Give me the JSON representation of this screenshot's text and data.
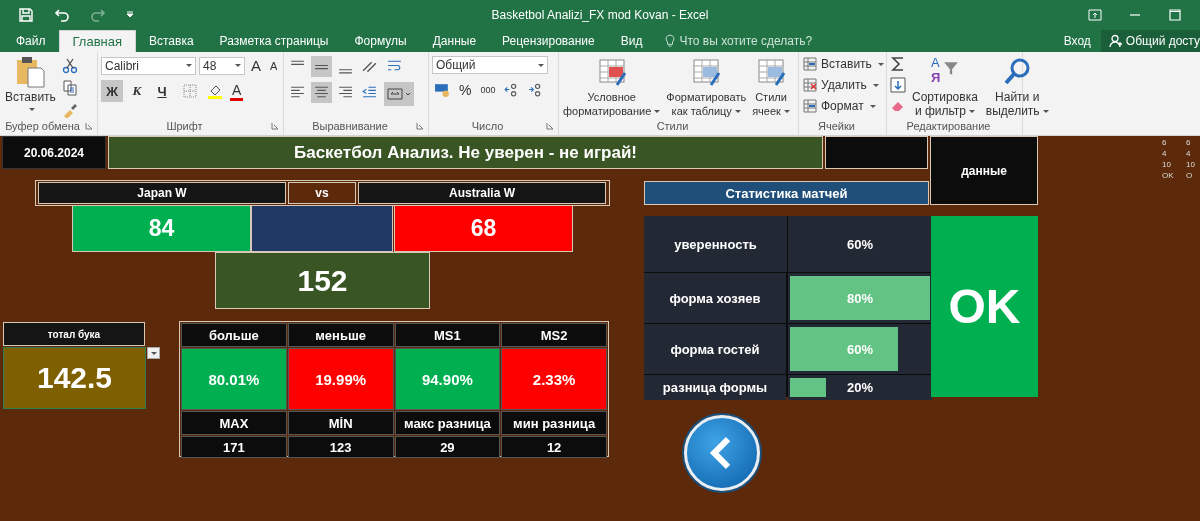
{
  "window": {
    "title": "Basketbol Analizi_FX mod Kovan - Excel"
  },
  "ribbon_tabs": [
    {
      "label": "Файл",
      "selected": false
    },
    {
      "label": "Главная",
      "selected": true
    },
    {
      "label": "Вставка",
      "selected": false
    },
    {
      "label": "Разметка страницы",
      "selected": false
    },
    {
      "label": "Формулы",
      "selected": false
    },
    {
      "label": "Данные",
      "selected": false
    },
    {
      "label": "Рецензирование",
      "selected": false
    },
    {
      "label": "Вид",
      "selected": false
    }
  ],
  "tell_me": {
    "placeholder": "Что вы хотите сделать?"
  },
  "account": {
    "sign_in": "Вход",
    "share": "Общий досту"
  },
  "ribbon": {
    "clipboard": {
      "label": "Буфер обмена",
      "paste": "Вставить"
    },
    "font": {
      "label": "Шрифт",
      "font_name": "Calibri",
      "font_size": "48",
      "grow": "A",
      "shrink": "A",
      "font_color": "A",
      "styles": [
        {
          "label": "Ж",
          "pressed": true
        },
        {
          "label": "К",
          "pressed": false
        },
        {
          "label": "Ч",
          "pressed": false
        }
      ]
    },
    "alignment": {
      "label": "Выравнивание",
      "vertical": [
        {
          "selected": false
        },
        {
          "selected": true
        },
        {
          "selected": false
        }
      ],
      "horizontal": [
        {
          "selected": false
        },
        {
          "selected": true
        },
        {
          "selected": false
        }
      ],
      "merge_on": true
    },
    "number": {
      "label": "Число",
      "format": "Общий",
      "percent": "%",
      "thousands": "000"
    },
    "styles": {
      "label": "Стили",
      "buttons": [
        {
          "lines": [
            "Условное",
            "форматирование"
          ]
        },
        {
          "lines": [
            "Форматировать",
            "как таблицу"
          ]
        },
        {
          "lines": [
            "Стили",
            "ячеек"
          ]
        }
      ]
    },
    "cells": {
      "label": "Ячейки",
      "items": [
        "Вставить",
        "Удалить",
        "Формат"
      ]
    },
    "editing": {
      "label": "Редактирование",
      "sort_glyphs": [
        "А",
        "Я"
      ],
      "buttons": [
        {
          "lines": [
            "Сортировка",
            "и фильтр"
          ]
        },
        {
          "lines": [
            "Найти и",
            "выделить"
          ]
        }
      ]
    }
  },
  "sheet": {
    "date": "20.06.2024",
    "title": "Баскетбол Анализ. Не уверен - не играй!",
    "data_button": "данные",
    "stats_title": "Статистика матчей",
    "match": {
      "home": "Japan W",
      "vs": "vs",
      "away": "Australia W",
      "home_score": "84",
      "away_score": "68",
      "total": "152"
    },
    "bookmaker_total": {
      "label": "тотал бука",
      "value": "142.5"
    },
    "odds": {
      "headers": [
        "больше",
        "меньше",
        "MS1",
        "MS2"
      ],
      "values": [
        {
          "text": "80.01%",
          "color": "#00b050"
        },
        {
          "text": "19.99%",
          "color": "#ff0000"
        },
        {
          "text": "94.90%",
          "color": "#00b050"
        },
        {
          "text": "2.33%",
          "color": "#ff0000"
        }
      ],
      "stat_headers": [
        "MAX",
        "MİN",
        "макс разница",
        "мин разница"
      ],
      "stat_values": [
        "171",
        "123",
        "29",
        "12"
      ]
    },
    "stats": [
      {
        "label": "уверенность",
        "value": "60%",
        "kind": "plain"
      },
      {
        "label": "форма хозяев",
        "value": "80%",
        "kind": "bar",
        "level": 1
      },
      {
        "label": "форма гостей",
        "value": "60%",
        "kind": "bar",
        "level": 0.75
      },
      {
        "label": "разница формы",
        "value": "20%",
        "kind": "bar",
        "level": 0.25
      }
    ],
    "verdict": "OK",
    "side_numbers": [
      [
        "6",
        "6"
      ],
      [
        "4",
        "4"
      ],
      [
        "10",
        "10"
      ],
      [
        "OK",
        "O"
      ]
    ]
  }
}
